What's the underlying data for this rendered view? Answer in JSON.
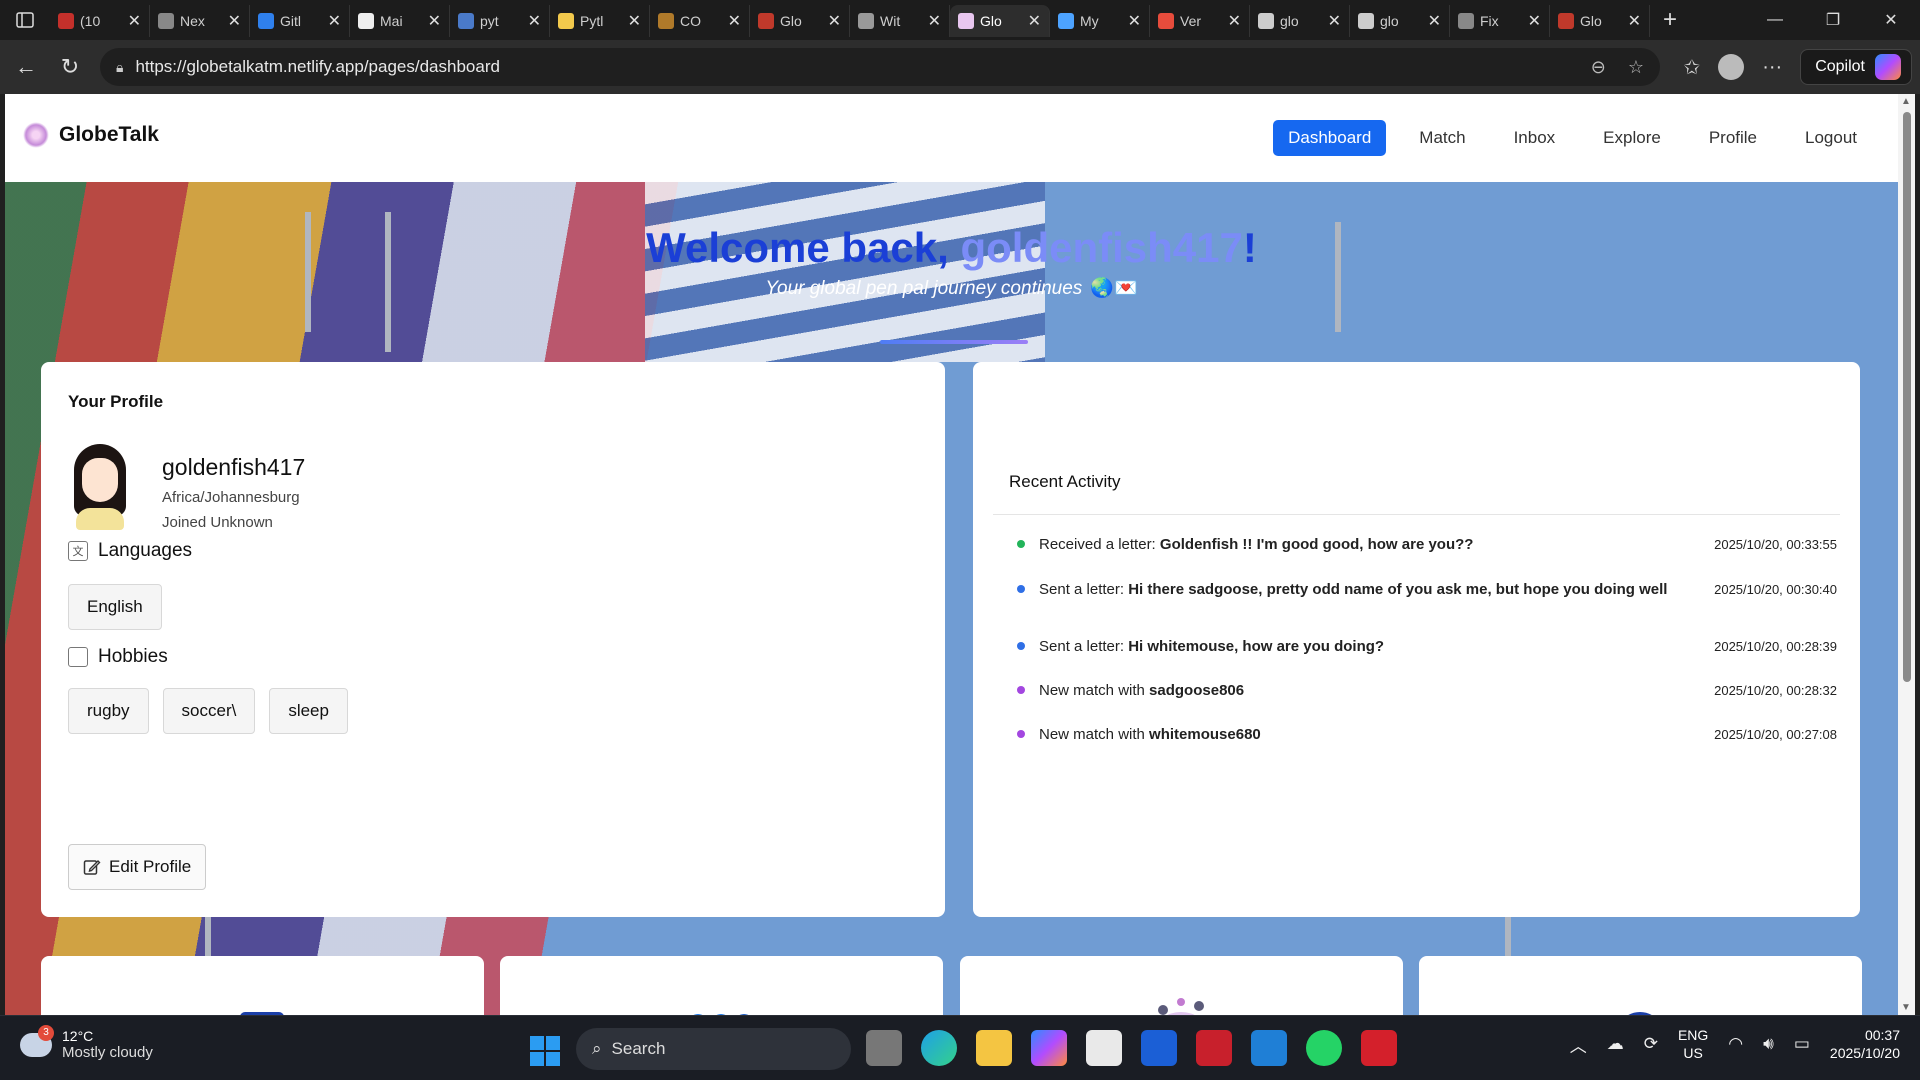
{
  "browser": {
    "tabs": [
      {
        "title": "(10",
        "color": "#c4302b"
      },
      {
        "title": "Nex",
        "color": "#888888"
      },
      {
        "title": "Gitl",
        "color": "#2f80ed"
      },
      {
        "title": "Mai",
        "color": "#eeeeee"
      },
      {
        "title": "pyt",
        "color": "#4a7ac9"
      },
      {
        "title": "Pytl",
        "color": "#f2c94c"
      },
      {
        "title": "CO",
        "color": "#b07a2a"
      },
      {
        "title": "Glo",
        "color": "#c0392b"
      },
      {
        "title": "Wit",
        "color": "#999999"
      },
      {
        "title": "Glo",
        "color": "#e8c6ef",
        "active": true
      },
      {
        "title": "My",
        "color": "#4da3ff"
      },
      {
        "title": "Ver",
        "color": "#e74c3c"
      },
      {
        "title": "glo",
        "color": "#cccccc"
      },
      {
        "title": "glo",
        "color": "#cccccc"
      },
      {
        "title": "Fix",
        "color": "#888888"
      },
      {
        "title": "Glo",
        "color": "#c0392b"
      }
    ],
    "url": "https://globetalkatm.netlify.app/pages/dashboard",
    "copilot_label": "Copilot"
  },
  "app": {
    "brand": "GlobeTalk",
    "nav": [
      {
        "label": "Dashboard",
        "active": true
      },
      {
        "label": "Match"
      },
      {
        "label": "Inbox"
      },
      {
        "label": "Explore"
      },
      {
        "label": "Profile"
      },
      {
        "label": "Logout"
      }
    ],
    "welcome_prefix": "Welcome back, ",
    "username": "goldenfish417",
    "welcome_suffix": "!",
    "subtitle": "Your global pen pal journey continues",
    "subtitle_emoji": "🌏💌"
  },
  "profile": {
    "heading": "Your Profile",
    "name": "goldenfish417",
    "timezone": "Africa/Johannesburg",
    "joined": "Joined Unknown",
    "languages_heading": "Languages",
    "languages": [
      "English"
    ],
    "hobbies_heading": "Hobbies",
    "hobbies": [
      "rugby",
      "soccer\\",
      "sleep"
    ],
    "edit_label": "Edit Profile"
  },
  "activity": {
    "heading": "Recent Activity",
    "items": [
      {
        "prefix": "Received a letter: ",
        "detail": "Goldenfish !! I'm good good, how are you??",
        "time": "2025/10/20, 00:33:55",
        "color": "#22b45a"
      },
      {
        "prefix": "Sent a letter: ",
        "detail": "Hi there sadgoose, pretty odd name of you ask me, but hope you doing well",
        "time": "2025/10/20, 00:30:40",
        "color": "#2f6fe6"
      },
      {
        "prefix": "Sent a letter: ",
        "detail": "Hi whitemouse, how are you doing?",
        "time": "2025/10/20, 00:28:39",
        "color": "#2f6fe6"
      },
      {
        "prefix": "New match with ",
        "detail": "sadgoose806",
        "time": "2025/10/20, 00:28:32",
        "color": "#a347e0"
      },
      {
        "prefix": "New match with ",
        "detail": "whitemouse680",
        "time": "2025/10/20, 00:27:08",
        "color": "#a347e0"
      }
    ]
  },
  "feature_cards": [
    {
      "icon": "envelope-icon"
    },
    {
      "icon": "bubbles-icon"
    },
    {
      "icon": "people-globe-icon"
    },
    {
      "icon": "clock-icon"
    }
  ],
  "taskbar": {
    "weather_temp": "12°C",
    "weather_cond": "Mostly cloudy",
    "weather_badge": "3",
    "search_label": "Search",
    "lang_line1": "ENG",
    "lang_line2": "US",
    "time": "00:37",
    "date": "2025/10/20"
  }
}
